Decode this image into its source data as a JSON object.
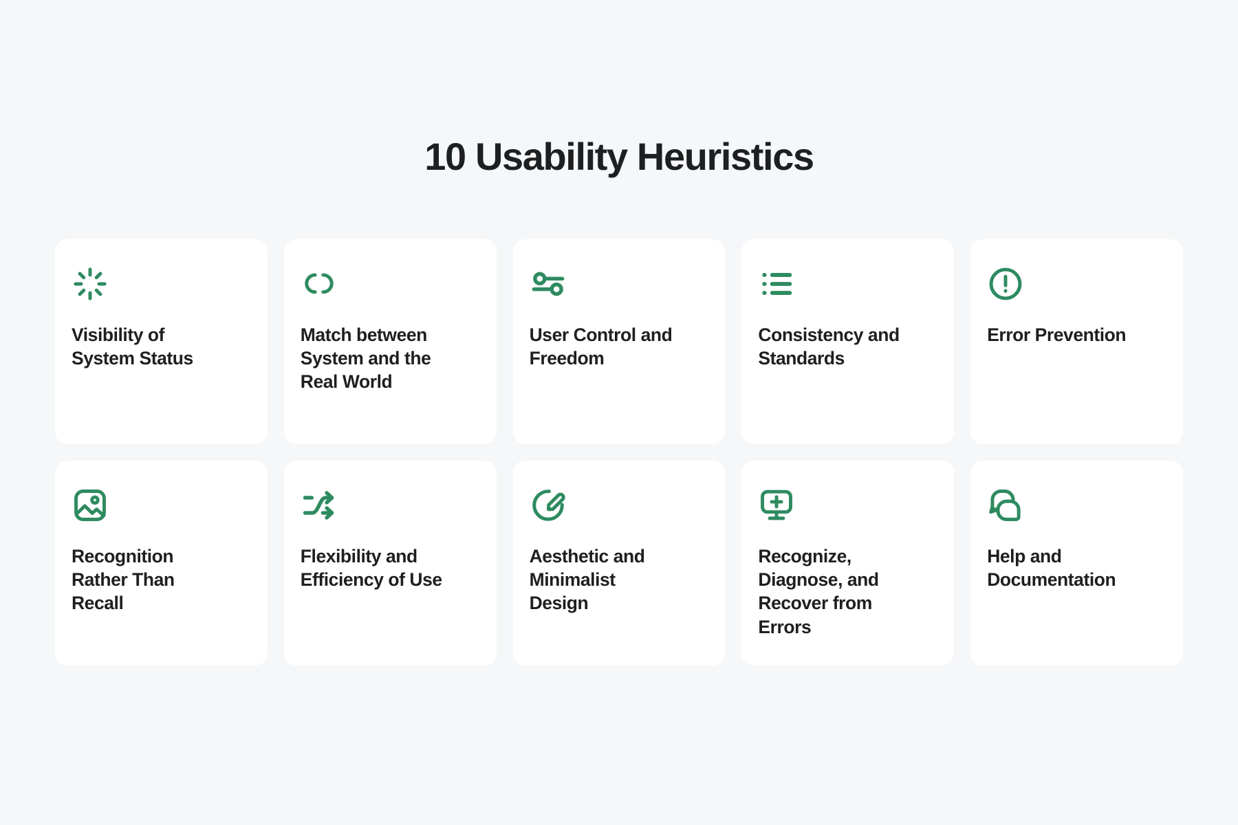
{
  "header": {
    "title": "10 Usability Heuristics"
  },
  "theme": {
    "background": "#f6f7f9",
    "card_background": "#ffffff",
    "icon_color": "#2e8b60",
    "text_color": "#1d1f21"
  },
  "cards": [
    {
      "icon": "loader-icon",
      "label": "Visibility of System Status"
    },
    {
      "icon": "link-icon",
      "label": "Match between System and the Real World"
    },
    {
      "icon": "sliders-icon",
      "label": "User Control and Freedom"
    },
    {
      "icon": "list-icon",
      "label": "Consistency and Standards"
    },
    {
      "icon": "alert-circle-icon",
      "label": "Error Prevention"
    },
    {
      "icon": "image-icon",
      "label": "Recognition Rather Than Recall"
    },
    {
      "icon": "shuffle-icon",
      "label": "Flexibility and Efficiency of Use"
    },
    {
      "icon": "edit-circle-icon",
      "label": "Aesthetic and Minimalist Design"
    },
    {
      "icon": "monitor-plus-icon",
      "label": "Recognize, Diagnose, and Recover from Errors"
    },
    {
      "icon": "chat-bubbles-icon",
      "label": "Help and Documentation"
    }
  ]
}
